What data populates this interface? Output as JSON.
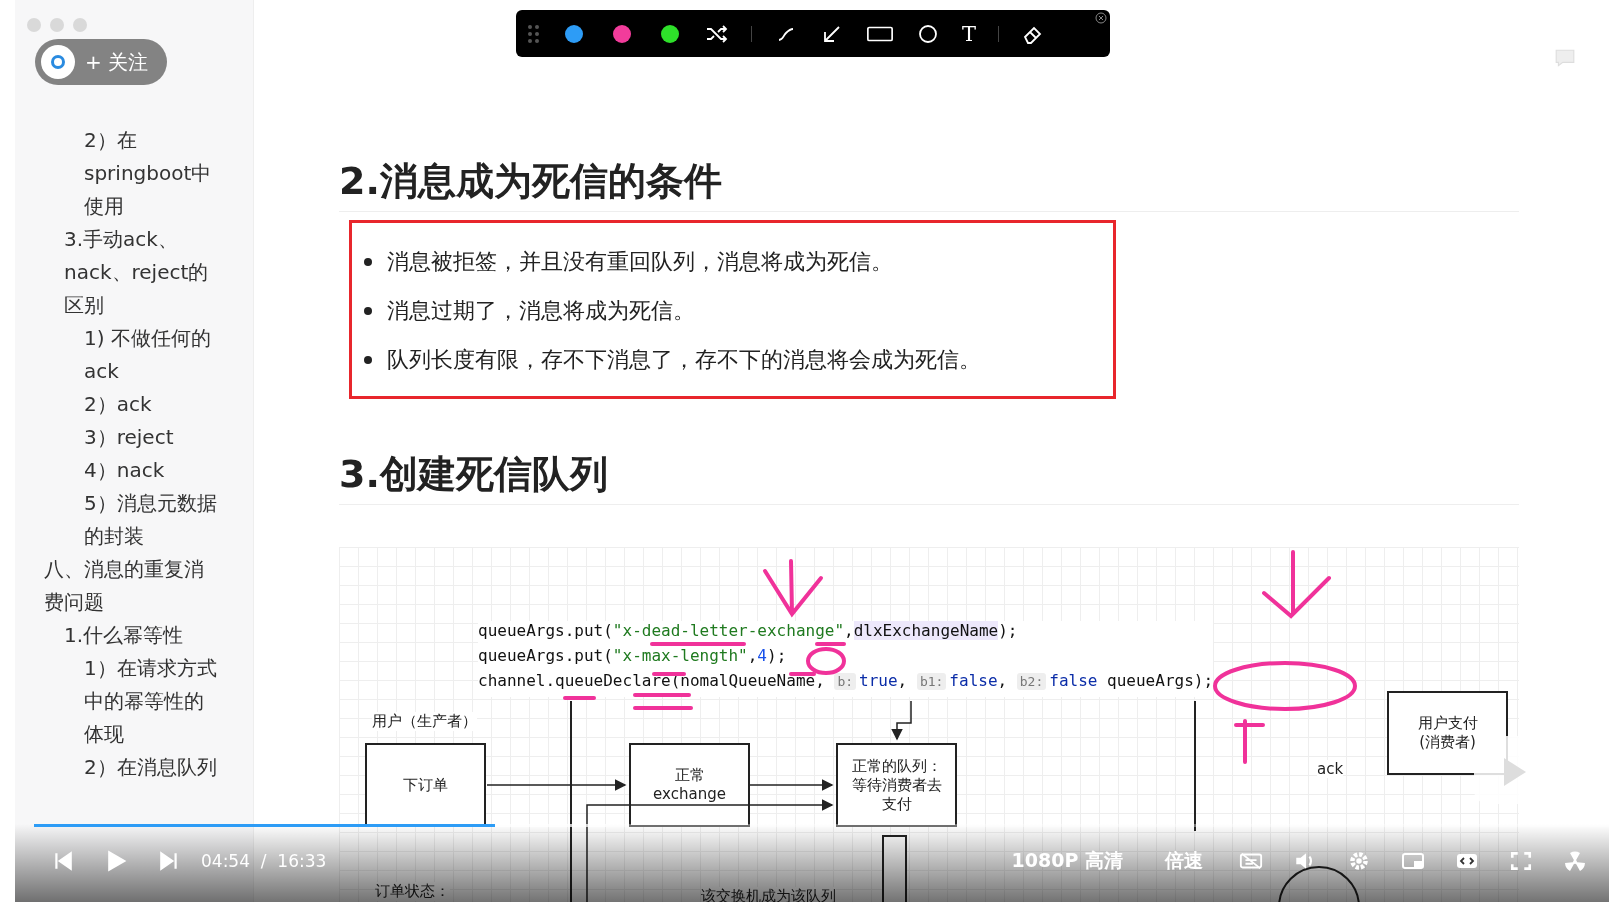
{
  "follow": {
    "label": "+ 关注"
  },
  "toolbar": {
    "colors": [
      {
        "color": "#2d9cf6"
      },
      {
        "color": "#f23c9b"
      },
      {
        "color": "#2ee02a"
      }
    ],
    "text_tool": "T"
  },
  "sidebar": {
    "items": [
      {
        "children": [
          {
            "children": [
              {
                "label": "2）在springboot中使用"
              }
            ]
          },
          {
            "label": "3.手动ack、nack、reject的区别",
            "children": [
              {
                "label": "1) 不做任何的ack"
              },
              {
                "label": "2）ack"
              },
              {
                "label": "3）reject"
              },
              {
                "label": "4）nack"
              },
              {
                "label": "5）消息元数据的封装"
              }
            ]
          }
        ]
      },
      {
        "label": "八、消息的重复消费问题",
        "children": [
          {
            "label": "1.什么幂等性",
            "children": [
              {
                "label": "1）在请求方式中的幂等性的体现"
              },
              {
                "label": "2）在消息队列"
              }
            ]
          }
        ]
      }
    ]
  },
  "doc": {
    "heading_1": "2.消息成为死信的条件",
    "bullets": [
      "消息被拒签，并且没有重回队列，消息将成为死信。",
      "消息过期了，消息将成为死信。",
      "队列长度有限，存不下消息了，存不下的消息将会成为死信。"
    ],
    "heading_2": "3.创建死信队列",
    "code": [
      [
        {
          "kind": "plain",
          "text": "queueArgs.put("
        },
        {
          "kind": "string",
          "text": "\"x-dead-letter-exchange\""
        },
        {
          "kind": "plain",
          "text": ","
        },
        {
          "kind": "highlight",
          "text": "dlxExchangeName"
        },
        {
          "kind": "plain",
          "text": ");"
        }
      ],
      [
        {
          "kind": "plain",
          "text": "queueArgs.put("
        },
        {
          "kind": "string",
          "text": "\"x-max-length\""
        },
        {
          "kind": "plain",
          "text": ","
        },
        {
          "kind": "number",
          "text": "4"
        },
        {
          "kind": "plain",
          "text": ");"
        }
      ],
      [
        {
          "kind": "plain",
          "text": "channel.queueDeclare(nomalQueueName, "
        },
        {
          "kind": "hint",
          "text": "b:"
        },
        {
          "kind": "keyword",
          "text": "true"
        },
        {
          "kind": "plain",
          "text": ", "
        },
        {
          "kind": "hint",
          "text": "b1:"
        },
        {
          "kind": "keyword",
          "text": "false"
        },
        {
          "kind": "plain",
          "text": ", "
        },
        {
          "kind": "hint",
          "text": "b2:"
        },
        {
          "kind": "keyword",
          "text": "false"
        },
        {
          "kind": "plain",
          "text": " queueArgs);"
        }
      ]
    ],
    "diagram": {
      "producer_label": "用户（生产者）",
      "order_box": "下订单",
      "exchange_box": "正常\nexchange",
      "queue_box": "正常的队列：等待消费者去支付",
      "consumer_box": "用户支付\n(消费者)",
      "ack_label": "ack",
      "order_status_label": "订单状态：",
      "exchange_note": "该交换机成为该队列"
    }
  },
  "player": {
    "progress": {
      "level": 0.293,
      "buffer": {
        "level": 0.363
      }
    },
    "time": "04:54  /  16:33",
    "quality": "1080P 高清",
    "speed": "倍速"
  }
}
